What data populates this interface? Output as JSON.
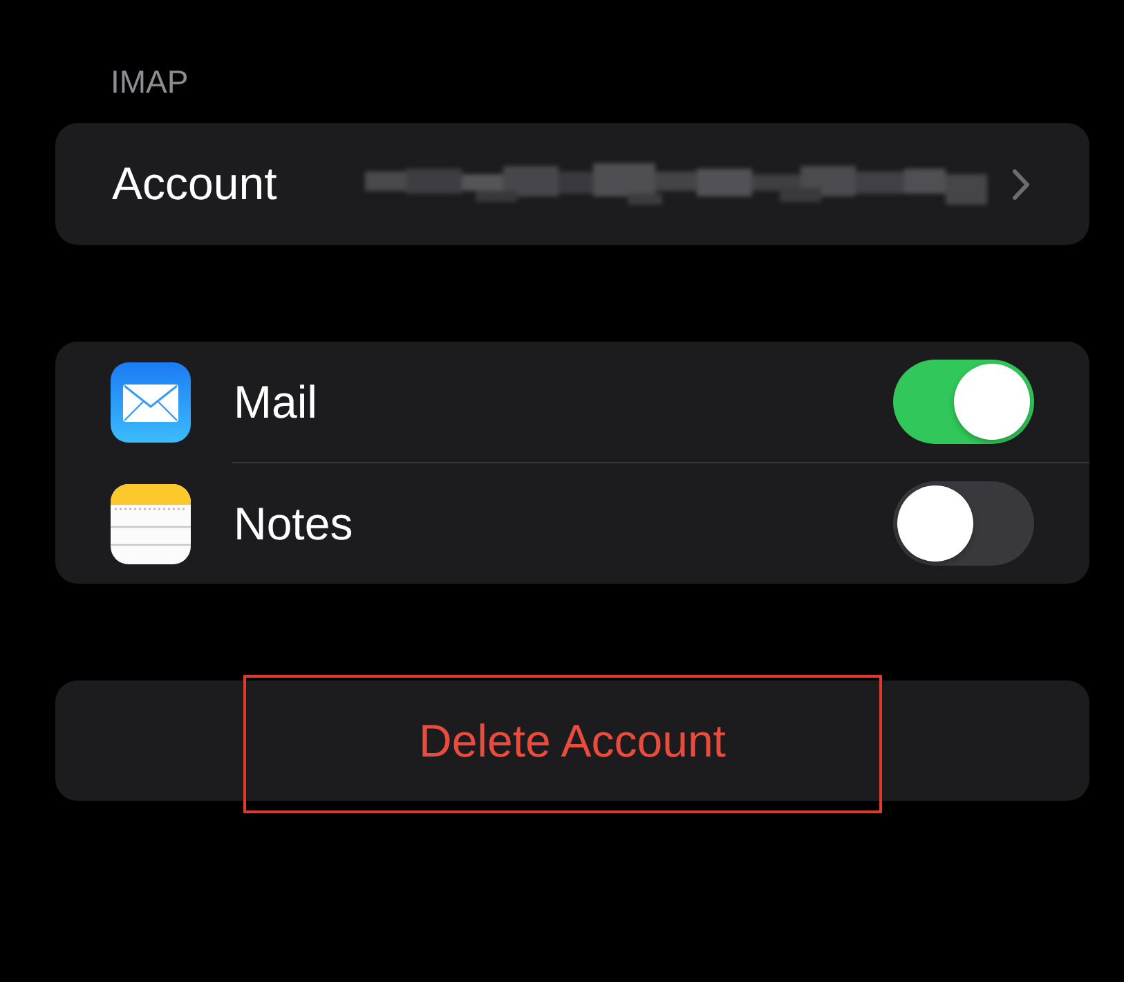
{
  "section_header": "IMAP",
  "account_row": {
    "label": "Account"
  },
  "apps": [
    {
      "kind": "mail",
      "label": "Mail",
      "on": true
    },
    {
      "kind": "notes",
      "label": "Notes",
      "on": false
    }
  ],
  "delete_button": {
    "label": "Delete Account",
    "highlighted": true
  }
}
